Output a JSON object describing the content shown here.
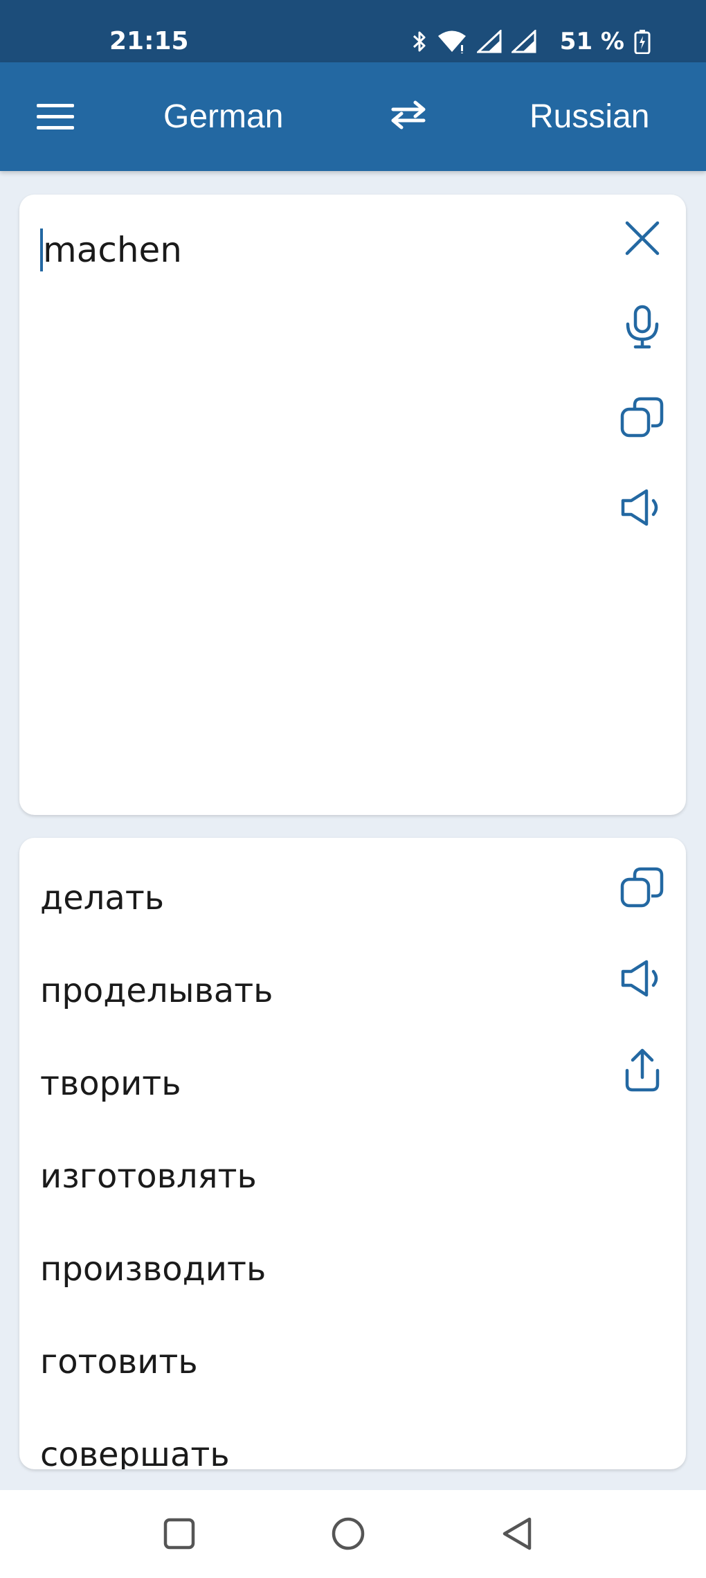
{
  "status_bar": {
    "time": "21:15",
    "battery": "51 %",
    "icons": [
      "bluetooth-icon",
      "wifi-icon",
      "signal-icon",
      "signal-icon",
      "battery-icon"
    ]
  },
  "app_bar": {
    "source_language": "German",
    "target_language": "Russian",
    "menu_icon": "menu-icon",
    "swap_icon": "swap-icon"
  },
  "input_card": {
    "text": "machen",
    "actions": [
      "clear-icon",
      "microphone-icon",
      "copy-icon",
      "speaker-icon"
    ]
  },
  "output_card": {
    "translations": [
      "делать",
      "проделывать",
      "творить",
      "изготовлять",
      "производить",
      "готовить",
      "совершать"
    ],
    "actions": [
      "copy-icon",
      "speaker-icon",
      "share-icon"
    ]
  },
  "nav_bar": {
    "buttons": [
      "recents-icon",
      "home-icon",
      "back-icon"
    ]
  },
  "colors": {
    "status_bar": "#1C4D7A",
    "app_bar": "#2368A2",
    "accent": "#2368A2",
    "background": "#E8EEF5",
    "card": "#FFFFFF",
    "text": "#1A1A1A"
  }
}
